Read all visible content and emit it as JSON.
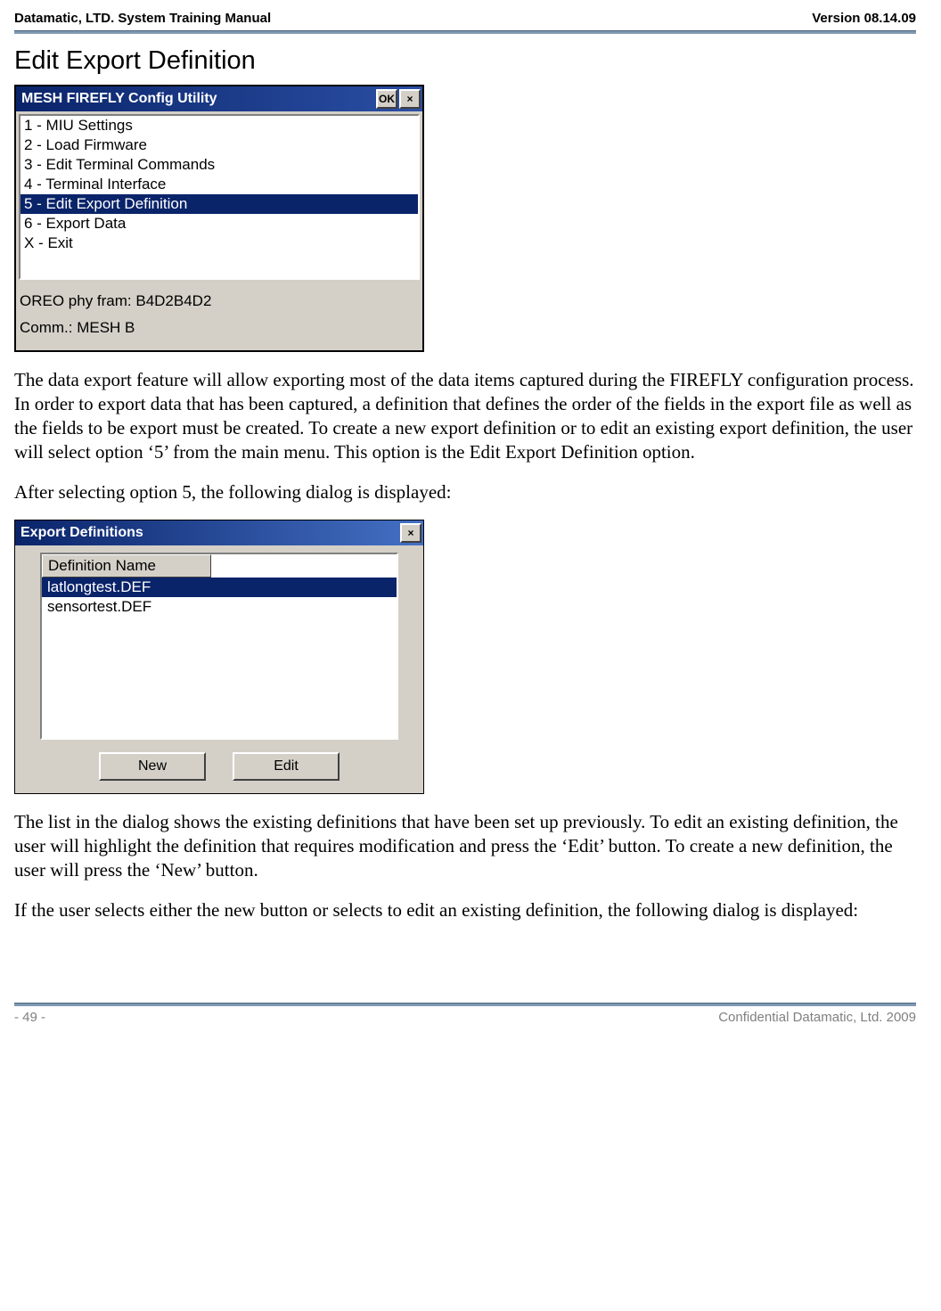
{
  "header": {
    "left": "Datamatic, LTD. System Training  Manual",
    "right": "Version 08.14.09"
  },
  "section_title": "Edit Export Definition",
  "window1": {
    "title": "MESH FIREFLY Config Utility",
    "ok_label": "OK",
    "close_label": "×",
    "items": [
      "1 - MIU Settings",
      "2 - Load Firmware",
      "3 - Edit Terminal Commands",
      "4 - Terminal Interface",
      "5 - Edit Export Definition",
      "6 - Export Data",
      "X - Exit"
    ],
    "selected_index": 4,
    "status1": "OREO phy fram: B4D2B4D2",
    "status2": "Comm.: MESH  B"
  },
  "para1": "The data export feature will allow exporting most of the data items captured during the FIREFLY configuration process.  In order to export data that has been captured, a definition that defines the order of the fields in the export file as well as the fields to be export must be created.  To create a new export definition or to edit an existing export definition, the user will select option ‘5’ from the main menu.  This option is the Edit Export Definition option.",
  "para2": "After selecting option 5, the following dialog is displayed:",
  "window2": {
    "title": "Export Definitions",
    "close_label": "×",
    "column_header": "Definition Name",
    "defs": [
      "latlongtest.DEF",
      "sensortest.DEF"
    ],
    "selected_index": 0,
    "new_label": "New",
    "edit_label": "Edit"
  },
  "para3": "The list in the dialog shows the existing definitions that have been set up previously.  To edit an existing definition, the user will highlight the definition that requires modification and press the ‘Edit’ button.  To create a new definition, the user will press the ‘New’ button.",
  "para4": "If the user selects either the new button or selects to edit an existing definition, the following dialog is displayed:",
  "footer": {
    "left": "- 49 -",
    "right": "Confidential Datamatic, Ltd. 2009"
  }
}
